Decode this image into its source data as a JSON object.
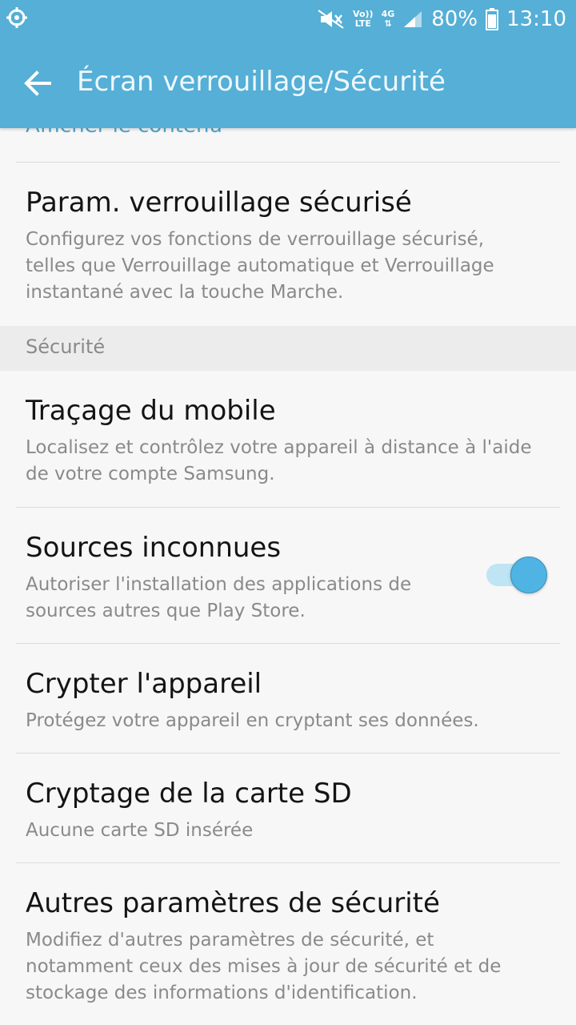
{
  "status_bar": {
    "volte_top": "Vo))",
    "volte_bottom": "LTE",
    "network": "4G",
    "battery": "80%",
    "time": "13:10",
    "icons": [
      "locator-icon",
      "mute-icon",
      "signal-icon",
      "battery-icon"
    ]
  },
  "app_bar": {
    "title": "Écran verrouillage/Sécurité",
    "back_icon": "arrow-left-icon"
  },
  "partial_item": {
    "title": "Afficher le contenu"
  },
  "items_lock": [
    {
      "title": "Param. verrouillage sécurisé",
      "desc": "Configurez vos fonctions de verrouillage sécurisé, telles que Verrouillage automatique et Verrouillage instantané avec la touche Marche."
    }
  ],
  "section": {
    "title": "Sécurité"
  },
  "items_security": [
    {
      "title": "Traçage du mobile",
      "desc": "Localisez et contrôlez votre appareil à distance à l'aide de votre compte Samsung."
    },
    {
      "title": "Sources inconnues",
      "desc": "Autoriser l'installation des applications de sources autres que Play Store.",
      "toggle_on": true
    },
    {
      "title": "Crypter l'appareil",
      "desc": "Protégez votre appareil en cryptant ses données."
    },
    {
      "title": "Cryptage de la carte SD",
      "desc": "Aucune carte SD insérée"
    },
    {
      "title": "Autres paramètres de sécurité",
      "desc": "Modifiez d'autres paramètres de sécurité, et notamment ceux des mises à jour de sécurité et de stockage des informations d'identification."
    }
  ],
  "colors": {
    "accent": "#55afd6",
    "toggle_on": "#4fb4e3",
    "title_text": "#141414",
    "desc_text": "#8a8a8a"
  }
}
